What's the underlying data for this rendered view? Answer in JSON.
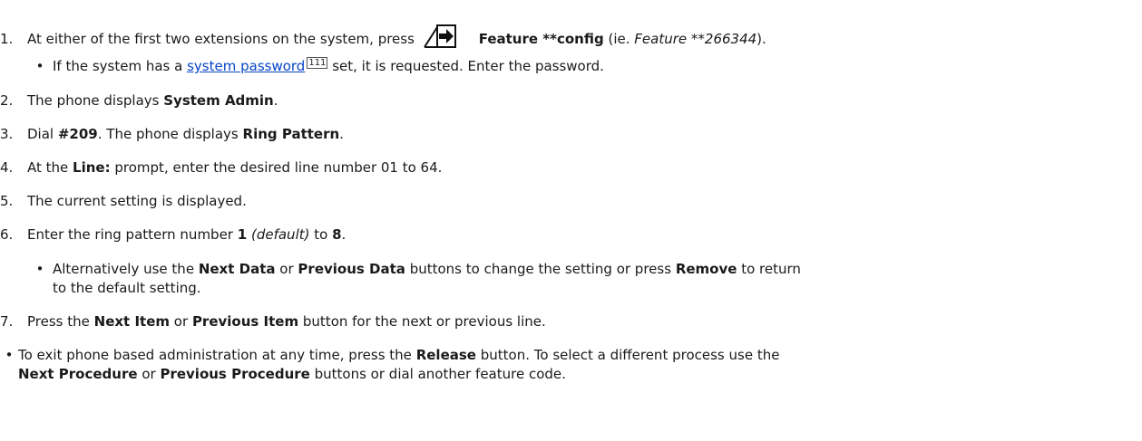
{
  "steps": {
    "s1": {
      "num": "1.",
      "t1": "At either of the first two extensions on the system, press",
      "b1": "Feature **config",
      "t2": "(ie.",
      "i1": "Feature **266344",
      "t3": ")."
    },
    "s1a": {
      "t1": "If the system has a",
      "link": "system password",
      "ref": "111",
      "t2": "set, it is requested. Enter the password."
    },
    "s2": {
      "num": "2.",
      "t1": "The phone displays",
      "b1": "System Admin",
      "t2": "."
    },
    "s3": {
      "num": "3.",
      "t1": "Dial",
      "b1": "#209",
      "t2": ". The phone displays",
      "b2": "Ring Pattern",
      "t3": "."
    },
    "s4": {
      "num": "4.",
      "t1": "At the",
      "b1": "Line:",
      "t2": "prompt, enter the desired line number 01 to 64."
    },
    "s5": {
      "num": "5.",
      "t1": "The current setting is displayed."
    },
    "s6": {
      "num": "6.",
      "t1": "Enter the ring pattern number",
      "b1": "1",
      "i1": "(default)",
      "t2": "to",
      "b2": "8",
      "t3": "."
    },
    "s6a": {
      "t1": "Alternatively use the",
      "b1": "Next Data",
      "t2": "or",
      "b2": "Previous Data",
      "t3": "buttons to change the setting or press",
      "b3": "Remove",
      "t4": "to return",
      "t5": "to the default setting."
    },
    "s7": {
      "num": "7.",
      "t1": "Press the",
      "b1": "Next Item",
      "t2": "or",
      "b2": "Previous Item",
      "t3": "button for the next or previous line."
    },
    "note": {
      "t1": "To exit phone based administration at any time, press the",
      "b1": "Release",
      "t2": "button. To select a different process use the",
      "b2": "Next Procedure",
      "t3": "or",
      "b3": "Previous Procedure",
      "t4": "buttons or dial another feature code."
    }
  },
  "icons": {
    "feature": "feature-arrow-icon"
  },
  "colors": {
    "link": "#0645c8",
    "text": "#1a1a1a"
  }
}
